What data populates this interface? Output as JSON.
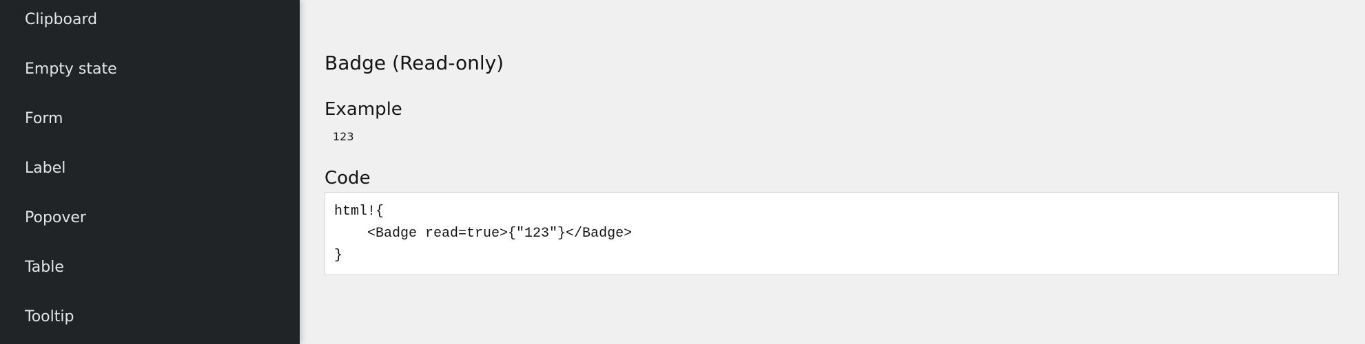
{
  "sidebar": {
    "items": [
      {
        "label": "Clipboard"
      },
      {
        "label": "Empty state"
      },
      {
        "label": "Form"
      },
      {
        "label": "Label"
      },
      {
        "label": "Popover"
      },
      {
        "label": "Table"
      },
      {
        "label": "Tooltip"
      }
    ]
  },
  "main": {
    "title": "Badge (Read-only)",
    "example_heading": "Example",
    "example_badge_value": "123",
    "code_heading": "Code",
    "code": "html!{\n    <Badge read=true>{\"123\"}</Badge>\n}"
  },
  "colors": {
    "sidebar_bg": "#212427",
    "sidebar_text": "#e4e5e6",
    "page_bg": "#f0f0f0",
    "code_bg": "#ffffff",
    "code_border": "#d2d2d2"
  }
}
